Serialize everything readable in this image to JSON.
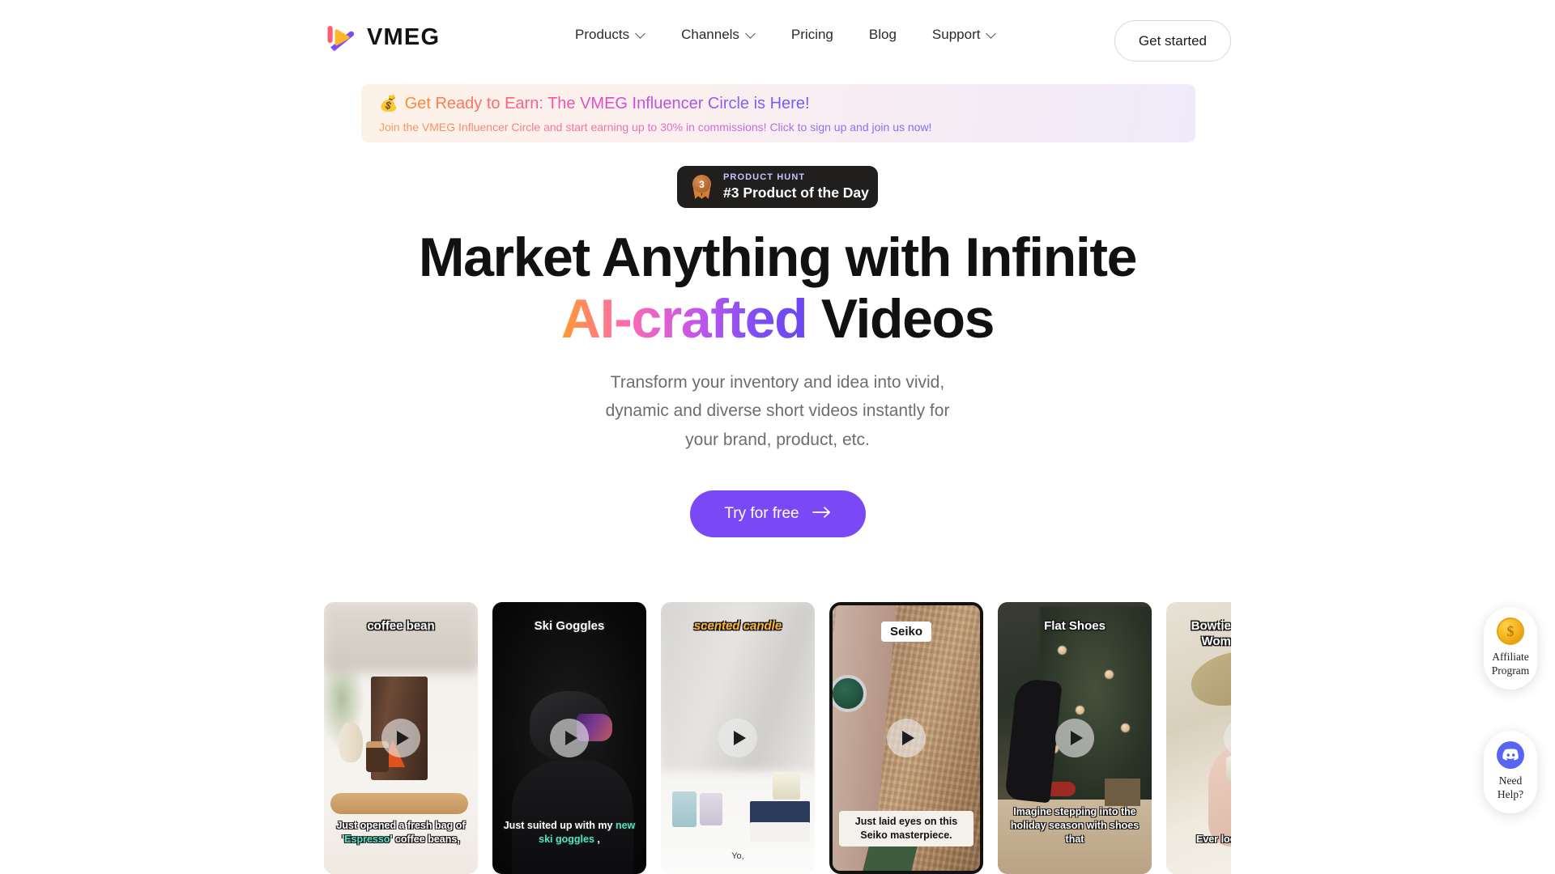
{
  "header": {
    "logo": {
      "icon": "vmeg-play-logo-icon",
      "text": "VMEG"
    },
    "nav": [
      {
        "label": "Products",
        "has_dropdown": true
      },
      {
        "label": "Channels",
        "has_dropdown": true
      },
      {
        "label": "Pricing",
        "has_dropdown": false
      },
      {
        "label": "Blog",
        "has_dropdown": false
      },
      {
        "label": "Support",
        "has_dropdown": true
      }
    ],
    "get_started_label": "Get started"
  },
  "promo_banner": {
    "emoji": "💰",
    "title": "Get Ready to Earn: The VMEG Influencer Circle is Here!",
    "subtitle": "Join the VMEG Influencer Circle and start earning up to 30% in commissions! Click to sign up and join us now!"
  },
  "product_hunt_badge": {
    "medal_rank": "3",
    "eyebrow": "PRODUCT HUNT",
    "title": "#3 Product of the Day"
  },
  "hero": {
    "title_line1": "Market Anything with Infinite",
    "title_highlight": "AI-crafted",
    "title_line2_rest": " Videos",
    "subtitle_line1": "Transform your inventory and idea into vivid,",
    "subtitle_line2": "dynamic and diverse short videos instantly for",
    "subtitle_line3": "your brand, product, etc.",
    "cta_label": "Try for free"
  },
  "video_cards": [
    {
      "label": "coffee bean",
      "label_style": "outlined",
      "caption_line1": "Just opened a fresh bag of '",
      "caption_highlight": "Espresso",
      "caption_line2": "' coffee beans,",
      "selected": false
    },
    {
      "label": "Ski Goggles",
      "label_style": "outlined",
      "caption_line1": "Just suited up with my ",
      "caption_highlight": "new ski goggles",
      "caption_line2": " ,",
      "selected": false
    },
    {
      "label": "scented candle",
      "label_style": "italic-orange",
      "caption_line1": "Yo,",
      "caption_highlight": "",
      "caption_line2": "",
      "selected": false
    },
    {
      "label": "Seiko",
      "label_style": "boxed",
      "caption_line1": "Just laid eyes on this Seiko masterpiece.",
      "caption_highlight": "",
      "caption_line2": "",
      "selected": true
    },
    {
      "label": "Flat Shoes",
      "label_style": "outlined",
      "caption_line1": "Imagine stepping into the holiday season with shoes that",
      "caption_highlight": "",
      "caption_line2": "",
      "selected": false
    },
    {
      "label": "Bowtie Accessory Women Shoes",
      "label_style": "outlined",
      "caption_line1": "Ever looked at your",
      "caption_highlight": "",
      "caption_line2": "",
      "selected": false
    }
  ],
  "side_widgets": [
    {
      "icon": "gold-coin-icon",
      "label_line1": "Affiliate",
      "label_line2": "Program"
    },
    {
      "icon": "discord-icon",
      "label_line1": "Need",
      "label_line2": "Help?"
    }
  ],
  "colors": {
    "cta_purple": "#7a49f5",
    "badge_dark": "#201f1e",
    "discord_blurple": "#5865F2",
    "caption_highlight": "#4fe3c1",
    "gradient_start": "#ff9a2e",
    "gradient_mid": "#ff6bb0",
    "gradient_end": "#6b45f2"
  }
}
